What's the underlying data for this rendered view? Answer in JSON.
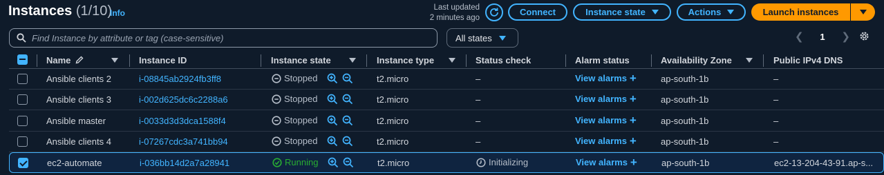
{
  "header": {
    "title": "Instances",
    "count": "(1/10)",
    "info": "Info",
    "last_updated_line1": "Last updated",
    "last_updated_line2": "2 minutes ago",
    "connect": "Connect",
    "instance_state": "Instance state",
    "actions": "Actions",
    "launch": "Launch instances"
  },
  "filter": {
    "search_placeholder": "Find Instance by attribute or tag (case-sensitive)",
    "states": "All states",
    "page": "1"
  },
  "columns": {
    "name": "Name",
    "instance_id": "Instance ID",
    "instance_state": "Instance state",
    "instance_type": "Instance type",
    "status_check": "Status check",
    "alarm_status": "Alarm status",
    "availability_zone": "Availability Zone",
    "public_dns": "Public IPv4 DNS"
  },
  "rows": [
    {
      "name": "Ansible clients 2",
      "id": "i-08845ab2924fb3ff8",
      "state": "Stopped",
      "type": "t2.micro",
      "status": "–",
      "alarm": "View alarms",
      "az": "ap-south-1b",
      "dns": "–"
    },
    {
      "name": "Ansible clients 3",
      "id": "i-002d625dc6c2288a6",
      "state": "Stopped",
      "type": "t2.micro",
      "status": "–",
      "alarm": "View alarms",
      "az": "ap-south-1b",
      "dns": "–"
    },
    {
      "name": "Ansible master",
      "id": "i-0033d3d3dca1588f4",
      "state": "Stopped",
      "type": "t2.micro",
      "status": "–",
      "alarm": "View alarms",
      "az": "ap-south-1b",
      "dns": "–"
    },
    {
      "name": "Ansible clients 4",
      "id": "i-07267cdc3a741bb94",
      "state": "Stopped",
      "type": "t2.micro",
      "status": "–",
      "alarm": "View alarms",
      "az": "ap-south-1b",
      "dns": "–"
    },
    {
      "name": "ec2-automate",
      "id": "i-036bb14d2a7a28941",
      "state": "Running",
      "type": "t2.micro",
      "status": "Initializing",
      "alarm": "View alarms",
      "az": "ap-south-1b",
      "dns": "ec2-13-204-43-91.ap-s..."
    }
  ],
  "colors": {
    "accent": "#42b4ff",
    "launch": "#ff9900",
    "running": "#29ad32",
    "background": "#0f1b2a"
  },
  "icons": [
    "refresh-icon",
    "search-icon",
    "pencil-icon",
    "settings-gear-icon",
    "zoom-in-icon",
    "zoom-out-icon",
    "stopped-status-icon",
    "running-status-icon",
    "clock-icon",
    "plus-icon"
  ]
}
